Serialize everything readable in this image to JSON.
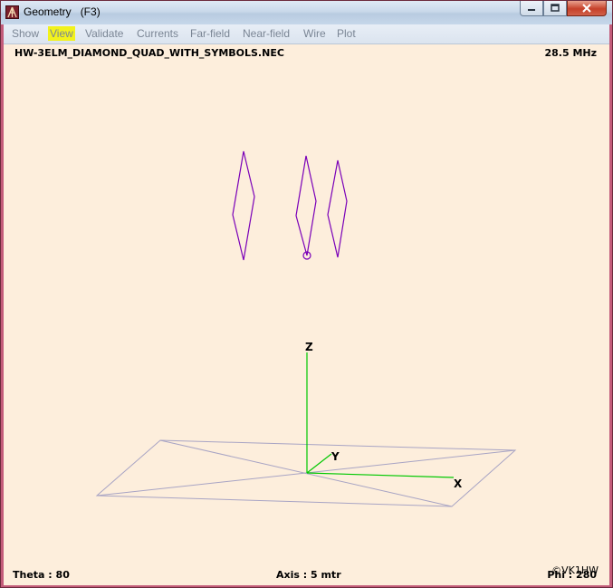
{
  "window": {
    "title": "Geometry",
    "shortcut": "(F3)",
    "icons": {
      "app": "antenna-app-icon",
      "minimize": "minimize-icon",
      "maximize": "maximize-icon",
      "close": "close-icon"
    }
  },
  "menu": {
    "items": [
      "Show",
      "View",
      "Validate",
      "Currents",
      "Far-field",
      "Near-field",
      "Wire",
      "Plot"
    ],
    "highlighted": "View"
  },
  "canvas": {
    "filename": "HW-3ELM_DIAMOND_QUAD_WITH_SYMBOLS.NEC",
    "frequency": "28.5 MHz",
    "theta": "Theta : 80",
    "axis": "Axis : 5 mtr",
    "phi": "Phi : 280",
    "copyright": "©VK1HW",
    "axes": {
      "z": "Z",
      "y": "Y",
      "x": "X"
    },
    "colors": {
      "background": "#fdeedc",
      "wire": "#7a00b8",
      "axis": "#00c800",
      "ground": "#a8a4c4",
      "highlight": "#f2f21c"
    }
  }
}
